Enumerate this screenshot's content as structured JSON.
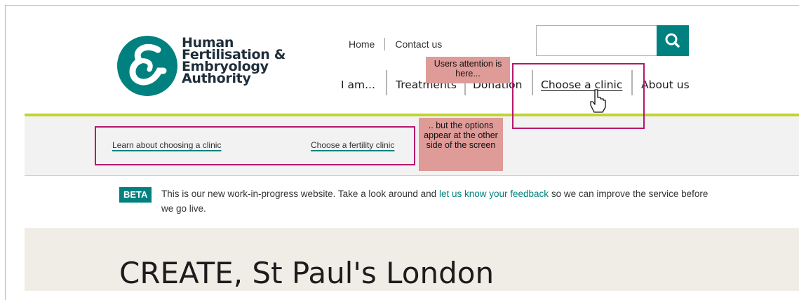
{
  "logo": {
    "lines": [
      "Human",
      "Fertilisation &",
      "Embryology",
      "Authority"
    ]
  },
  "utility_nav": {
    "home": "Home",
    "contact": "Contact us"
  },
  "search": {
    "placeholder": "",
    "icon": "search-icon"
  },
  "main_nav": {
    "items": [
      "I am...",
      "Treatments",
      "Donation",
      "Choose a clinic",
      "About us"
    ],
    "active": "Choose a clinic"
  },
  "sub_nav": {
    "items": [
      "Learn about choosing a clinic",
      "Choose a fertility clinic"
    ]
  },
  "beta": {
    "badge": "BETA",
    "text_before": "This is our new work-in-progress website. Take a look around and",
    "link": "let us know your feedback",
    "text_after": "so we can improve the service before we go live."
  },
  "hero": {
    "title": "CREATE, St Paul's London"
  },
  "annotations": {
    "attention_note": "Users attention is here...",
    "options_note": ".. but the options appear at the other side of the screen"
  },
  "colors": {
    "brand_teal": "#00817f",
    "accent_green": "#c2d42c",
    "highlight_magenta": "#b5176e",
    "note_pink": "#de9b98"
  }
}
